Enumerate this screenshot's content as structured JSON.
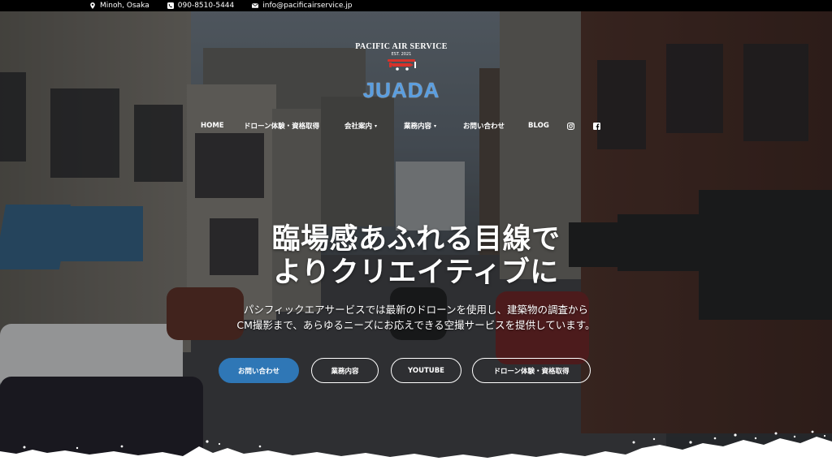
{
  "topbar": {
    "location": "Minoh, Osaka",
    "phone": "090-8510-5444",
    "email": "info@pacificairservice.jp"
  },
  "logo": {
    "name": "PACIFIC AIR SERVICE",
    "est": "EST. 2021",
    "mark": "JUADA"
  },
  "nav": {
    "items": [
      {
        "label": "HOME",
        "dropdown": false
      },
      {
        "label": "ドローン体験・資格取得",
        "dropdown": false
      },
      {
        "label": "会社案内",
        "dropdown": true
      },
      {
        "label": "業務内容",
        "dropdown": true
      },
      {
        "label": "お問い合わせ",
        "dropdown": false
      },
      {
        "label": "BLOG",
        "dropdown": false
      }
    ],
    "social": [
      "instagram-icon",
      "facebook-icon"
    ]
  },
  "hero": {
    "headline_line1": "臨場感あふれる目線で",
    "headline_line2": "よりクリエイティブに",
    "sub_line1": "パシフィックエアサービスでは最新のドローンを使用し、建築物の調査から",
    "sub_line2": "CM撮影まで、あらゆるニーズにお応えできる空撮サービスを提供しています。"
  },
  "buttons": {
    "contact": "お問い合わせ",
    "services": "業務内容",
    "youtube": "YOUTUBE",
    "drone": "ドローン体験・資格取得"
  },
  "colors": {
    "primary_button": "#2f77b6",
    "topbar": "#000000",
    "logo_blue": "#5a9ee0"
  }
}
